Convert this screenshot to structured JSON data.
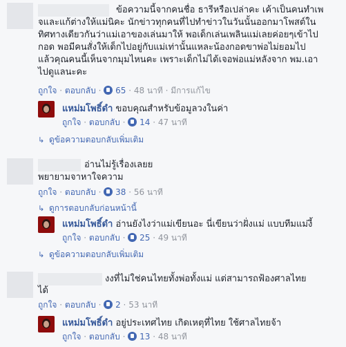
{
  "comments": [
    {
      "text_line1": "ข้อความนี้จากคนชื่อ ธารีหรือเปล่าคะ เค้าเป็นคนทำเพ",
      "text_lines": [
        "จและแก้ต่างให้แม่นิคะ นักข่าวทุกคนที่ไปทำข่าวในวันนั้นออกมาโพสต์ใน",
        "ทิศทางเดียวกันว่าแม่เอาของเล่นมาให้ พอเด็กเล่นเพลินแม่เลยค่อยๆเข้าไป",
        "กอด พอมีคนสั่งให้เด็กไปอยู่กับแม่เท่านั้นแหละน้องกอดขาพ่อไม่ยอมไป",
        "แล้วคุณคนนี้เห็นจากมุมไหนคะ เพราะเด็กไม่ได้เจอพ่อแม่หลังจาก พม.เอา",
        "ไปดูแลนะคะ"
      ],
      "like": "ถูกใจ",
      "reply": "ตอบกลับ",
      "count": "65",
      "time": "48 นาที",
      "edited": "มีการแก้ไข",
      "reply_item": {
        "name": "แหม่มโพธิ์ดำ",
        "text": "ขอบคุณสำหรับข้อมูลวงในค่า",
        "like": "ถูกใจ",
        "reply": "ตอบกลับ",
        "count": "14",
        "time": "47 นาที"
      },
      "more": "ดูข้อความตอบกลับเพิ่มเติม"
    },
    {
      "text_line1": "อ่านไม่รู้เรื่องเลยย",
      "text_line2": "พยายามจาหาใจความ",
      "like": "ถูกใจ",
      "reply": "ตอบกลับ",
      "count": "38",
      "time": "56 นาที",
      "prev": "ดูการตอบกลับก่อนหน้านี้",
      "reply_item": {
        "name": "แหม่มโพธิ์ดำ",
        "text": "อ่านยังไงว่าแม่เขียนอะ นี่เขียนว่าฝั่งแม่ แบบทีมแม่งี้",
        "like": "ถูกใจ",
        "reply": "ตอบกลับ",
        "count": "25",
        "time": "49 นาที"
      },
      "more": "ดูข้อความตอบกลับเพิ่มเติม"
    },
    {
      "text_line1": "งงที่ไม่ใช่คนไทยทั้งพ่อทั้งแม่ แต่สามารถฟ้องศาลไทย",
      "text_line2": "ได้",
      "like": "ถูกใจ",
      "reply": "ตอบกลับ",
      "count": "2",
      "time": "53 นาที",
      "reply_item": {
        "name": "แหม่มโพธิ์ดำ",
        "text": "อยู่ประเทศไทย เกิดเหตุที่ไทย ใช้ศาลไทยจ้า",
        "like": "ถูกใจ",
        "reply": "ตอบกลับ",
        "count": "13",
        "time": "48 นาที"
      }
    }
  ],
  "separator": "·"
}
